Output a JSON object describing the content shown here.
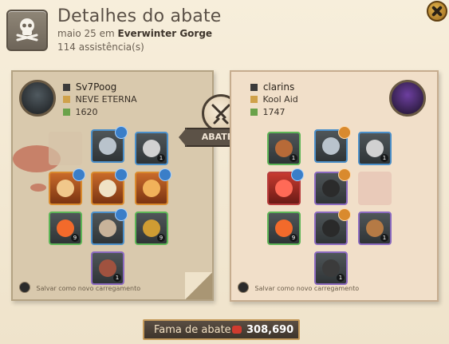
{
  "header": {
    "title": "Detalhes do abate",
    "date_prefix": "maio 25 em",
    "location": "Everwinter Gorge",
    "assist_count": "114",
    "assist_label": "assistência(s)"
  },
  "center": {
    "ribbon_label": "ABATEU"
  },
  "left_player": {
    "name": "Sv7Poog",
    "guild": "NEVE ETERNA",
    "ip": "1620"
  },
  "right_player": {
    "name": "clarins",
    "guild": "Kool Aid",
    "ip": "1747"
  },
  "save_label": "Salvar como novo carregamento",
  "footer": {
    "fame_label": "Fama de abate",
    "fame_value": "308,690"
  },
  "colors": {
    "accent_gold": "#c59a5a",
    "tile_blue": "#4b8fc9",
    "tile_green": "#5db556",
    "tile_purple": "#8b6ac0",
    "tile_orange": "#d98a2e"
  },
  "icons": {
    "header": "skull-crossbones-icon",
    "center": "crossed-swords-icon",
    "fame": "fame-icon",
    "close": "close-icon"
  }
}
